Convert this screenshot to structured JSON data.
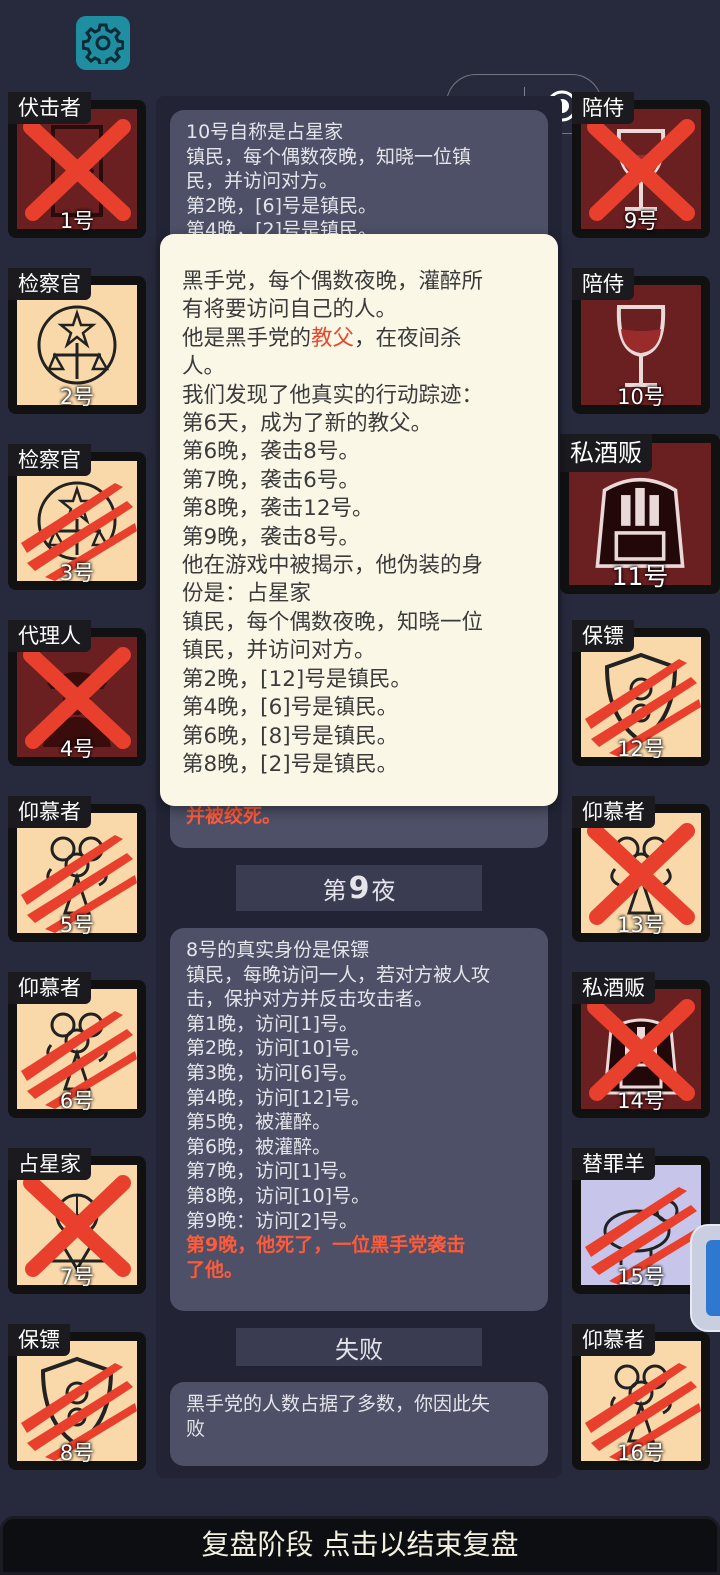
{
  "colors": {
    "background": "#272a3d",
    "log_card": "#4d5066",
    "popup_bg": "#fbf7e7",
    "cream_card": "#f9d9a9",
    "maroon_card": "#6a1f20",
    "lilac_card": "#c8c5eb",
    "x_red": "#e8402c",
    "highlight_red": "#ff5a3a"
  },
  "toolbar": {
    "settings_icon": "gear-icon",
    "menu_icon": "more-dots-icon",
    "close_icon": "target-circle-icon"
  },
  "left_players": [
    {
      "role": "伏击者",
      "number": "1号",
      "bg": "maroon",
      "mark": "x",
      "icon": "door-icon"
    },
    {
      "role": "检察官",
      "number": "2号",
      "bg": "cream",
      "mark": "none",
      "icon": "justice-emblem-icon"
    },
    {
      "role": "检察官",
      "number": "3号",
      "bg": "cream",
      "mark": "claw",
      "icon": "justice-emblem-icon"
    },
    {
      "role": "代理人",
      "number": "4号",
      "bg": "maroon",
      "mark": "x",
      "icon": "agent-icon"
    },
    {
      "role": "仰慕者",
      "number": "5号",
      "bg": "cream",
      "mark": "claw",
      "icon": "bouquet-icon"
    },
    {
      "role": "仰慕者",
      "number": "6号",
      "bg": "cream",
      "mark": "claw",
      "icon": "bouquet-icon"
    },
    {
      "role": "占星家",
      "number": "7号",
      "bg": "cream",
      "mark": "x",
      "icon": "astrolabe-icon"
    },
    {
      "role": "保镖",
      "number": "8号",
      "bg": "cream",
      "mark": "claw",
      "icon": "shield-icon"
    }
  ],
  "right_players": [
    {
      "role": "陪侍",
      "number": "9号",
      "bg": "maroon",
      "mark": "x",
      "icon": "wine-glass-icon"
    },
    {
      "role": "陪侍",
      "number": "10号",
      "bg": "maroon",
      "mark": "none",
      "icon": "wine-glass-icon"
    },
    {
      "role": "私酒贩",
      "number": "11号",
      "bg": "maroon",
      "mark": "none",
      "icon": "bootlegger-icon"
    },
    {
      "role": "保镖",
      "number": "12号",
      "bg": "cream",
      "mark": "claw",
      "icon": "shield-icon"
    },
    {
      "role": "仰慕者",
      "number": "13号",
      "bg": "cream",
      "mark": "x",
      "icon": "bouquet-icon"
    },
    {
      "role": "私酒贩",
      "number": "14号",
      "bg": "maroon",
      "mark": "x",
      "icon": "bootlegger-icon"
    },
    {
      "role": "替罪羊",
      "number": "15号",
      "bg": "lilac",
      "mark": "claw",
      "icon": "scapegoat-icon"
    },
    {
      "role": "仰慕者",
      "number": "16号",
      "bg": "cream",
      "mark": "claw",
      "icon": "bouquet-icon"
    }
  ],
  "log": {
    "card1_lines": [
      "10号自称是占星家",
      "镇民，每个偶数夜晚，知晓一位镇",
      "民，并访问对方。",
      "第2晚，[6]号是镇民。",
      "第4晚，[2]号是镇民。"
    ],
    "card1_tail_red": "并被绞死。",
    "night9_prefix": "第",
    "night9_num": "9",
    "night9_suffix": "夜",
    "card2_lines": [
      "8号的真实身份是保镖",
      "镇民，每晚访问一人，若对方被人攻",
      "击，保护对方并反击攻击者。",
      "第1晚，访问[1]号。",
      "第2晚，访问[10]号。",
      "第3晚，访问[6]号。",
      "第4晚，访问[12]号。",
      "第5晚，被灌醉。",
      "第6晚，被灌醉。",
      "第7晚，访问[1]号。",
      "第8晚，访问[10]号。",
      "第9晚：访问[2]号。"
    ],
    "card2_red_lines": [
      "第9晚，他死了，一位黑手党袭击",
      "了他。"
    ],
    "fail_header": "失败",
    "card3_lines": [
      "黑手党的人数占据了多数，你因此失",
      "败"
    ]
  },
  "popup": {
    "line1": "黑手党，每个偶数夜晚，灌醉所",
    "line2": "有将要访问自己的人。",
    "line3_pre": "他是黑手党的",
    "line3_red": "教父",
    "line3_post": "，在夜间杀",
    "line4": "人。",
    "lines_rest": [
      "我们发现了他真实的行动踪迹：",
      "第6天，成为了新的教父。",
      "第6晚，袭击8号。",
      "第7晚，袭击6号。",
      "第8晚，袭击12号。",
      "第9晚，袭击8号。",
      "他在游戏中被揭示，他伪装的身",
      "份是：占星家",
      "镇民，每个偶数夜晚，知晓一位",
      "镇民，并访问对方。",
      "第2晚，[12]号是镇民。",
      "第4晚，[6]号是镇民。",
      "第6晚，[8]号是镇民。",
      "第8晚，[2]号是镇民。"
    ]
  },
  "bottom_bar": {
    "label": "复盘阶段 点击以结束复盘"
  }
}
